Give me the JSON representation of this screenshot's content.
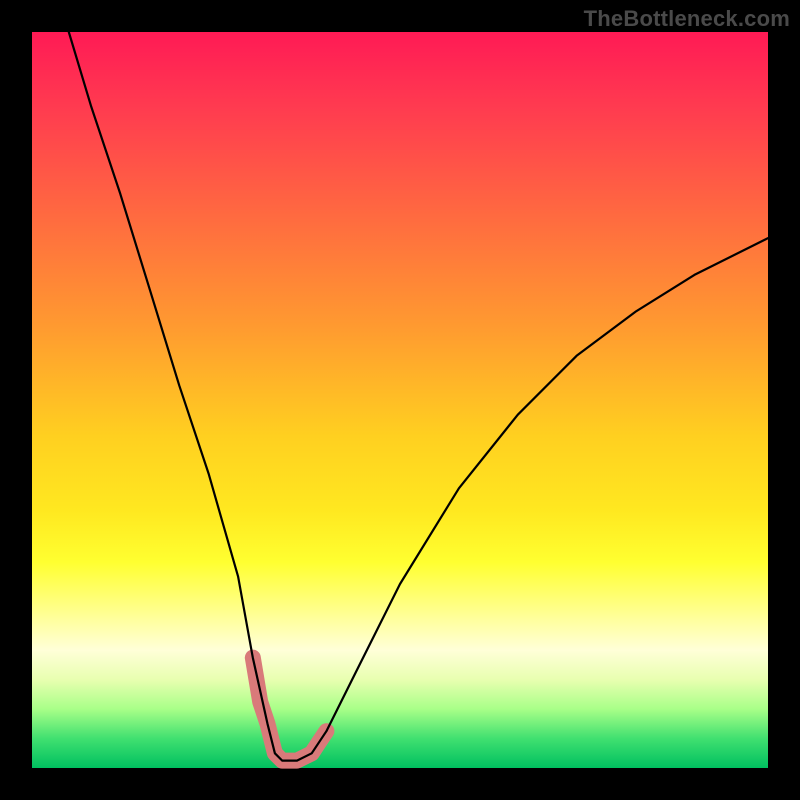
{
  "attribution": "TheBottleneck.com",
  "chart_data": {
    "type": "line",
    "title": "",
    "xlabel": "",
    "ylabel": "",
    "xlim": [
      0,
      100
    ],
    "ylim": [
      0,
      100
    ],
    "series": [
      {
        "name": "bottleneck-curve",
        "x": [
          5,
          8,
          12,
          16,
          20,
          24,
          28,
          30,
          32,
          33,
          34,
          36,
          38,
          40,
          44,
          50,
          58,
          66,
          74,
          82,
          90,
          100
        ],
        "values": [
          100,
          90,
          78,
          65,
          52,
          40,
          26,
          15,
          6,
          2,
          1,
          1,
          2,
          5,
          13,
          25,
          38,
          48,
          56,
          62,
          67,
          72
        ]
      }
    ],
    "highlight": {
      "name": "near-zero-band",
      "x": [
        30,
        31,
        32,
        33,
        34,
        35,
        36,
        37,
        38,
        39,
        40
      ],
      "values": [
        15,
        9,
        6,
        2,
        1,
        1,
        1,
        1.5,
        2,
        3.5,
        5
      ]
    },
    "colors": {
      "curve": "#000000",
      "highlight": "#d97a7a",
      "frame": "#000000"
    }
  }
}
